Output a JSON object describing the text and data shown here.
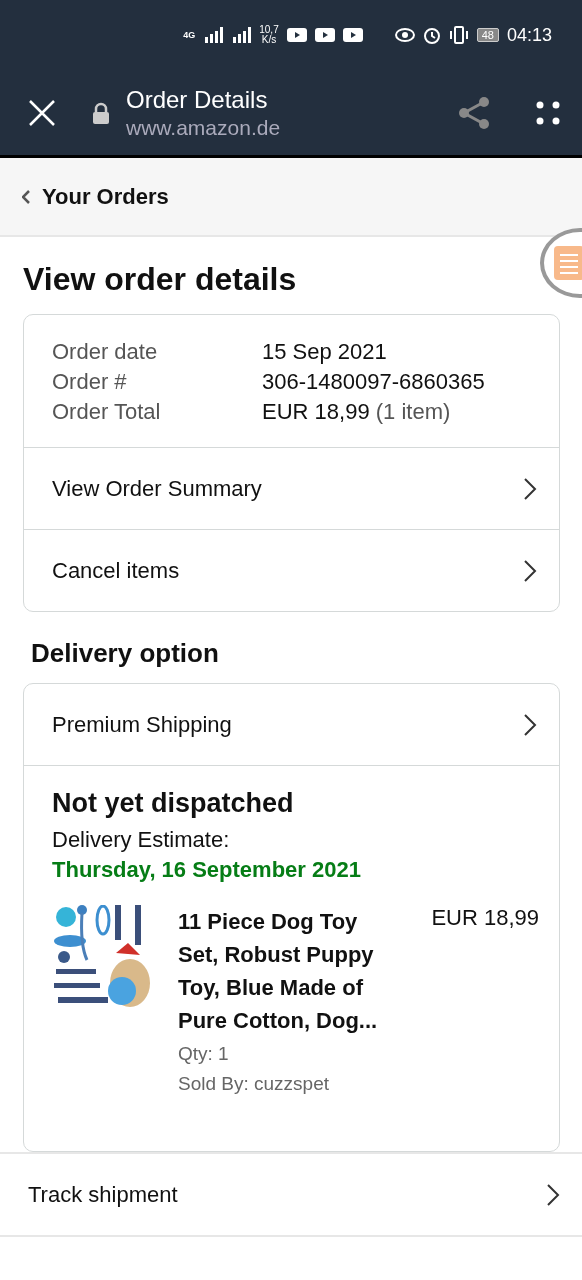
{
  "status_bar": {
    "network": "4G",
    "speed": [
      "10,7",
      "K/s"
    ],
    "battery": "48",
    "time": "04:13"
  },
  "browser": {
    "title": "Order Details",
    "url": "www.amazon.de"
  },
  "breadcrumb": {
    "label": "Your Orders"
  },
  "heading": "View order details",
  "order_info": [
    {
      "label": "Order date",
      "value": "15 Sep 2021"
    },
    {
      "label": "Order #",
      "value": "306-1480097-6860365"
    },
    {
      "label": "Order Total",
      "value": "EUR 18,99",
      "note": "(1 item)"
    }
  ],
  "order_links": [
    "View Order Summary",
    "Cancel items"
  ],
  "delivery": {
    "heading": "Delivery option",
    "method": "Premium Shipping",
    "status": "Not yet dispatched",
    "estimate_label": "Delivery Estimate:",
    "estimate_date": "Thursday, 16 September 2021"
  },
  "item": {
    "kind": "picture",
    "title": "11 Piece Dog Toy Set, Robust Puppy Toy, Blue Made of Pure Cotton, Dog...",
    "price": "EUR 18,99",
    "qty": "Qty: 1",
    "seller": "Sold By: cuzzspet"
  },
  "footer_links": [
    "Track shipment"
  ]
}
